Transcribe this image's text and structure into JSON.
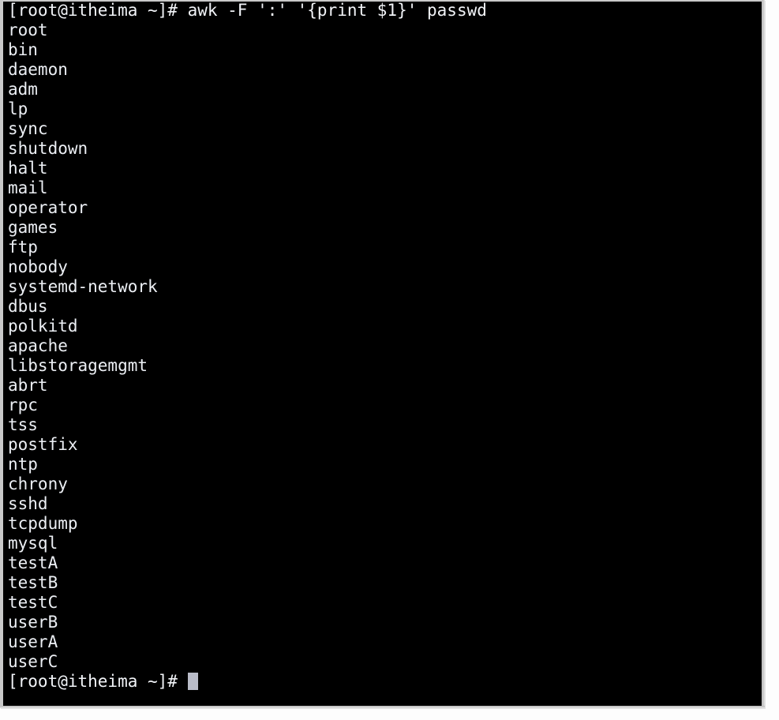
{
  "window": {
    "app_name": "terminal",
    "frame_color": "#c9c9c9",
    "background_color": "#000000",
    "foreground_color": "#eceff4",
    "cursor_color": "#b9bcc8",
    "page_background": "#fdfdfd"
  },
  "terminal": {
    "prompt": "[root@itheima ~]#",
    "command": "awk -F ':' '{print $1}' passwd",
    "command_line": "[root@itheima ~]# awk -F ':' '{print $1}' passwd",
    "output_lines": [
      "root",
      "bin",
      "daemon",
      "adm",
      "lp",
      "sync",
      "shutdown",
      "halt",
      "mail",
      "operator",
      "games",
      "ftp",
      "nobody",
      "systemd-network",
      "dbus",
      "polkitd",
      "apache",
      "libstoragemgmt",
      "abrt",
      "rpc",
      "tss",
      "postfix",
      "ntp",
      "chrony",
      "sshd",
      "tcpdump",
      "mysql",
      "testA",
      "testB",
      "testC",
      "userB",
      "userA",
      "userC"
    ],
    "final_prompt": "[root@itheima ~]# ",
    "cursor": {
      "shape": "block",
      "visible": true,
      "column": 19,
      "row": 36
    },
    "line_count": 35,
    "output_line_count": 33
  }
}
